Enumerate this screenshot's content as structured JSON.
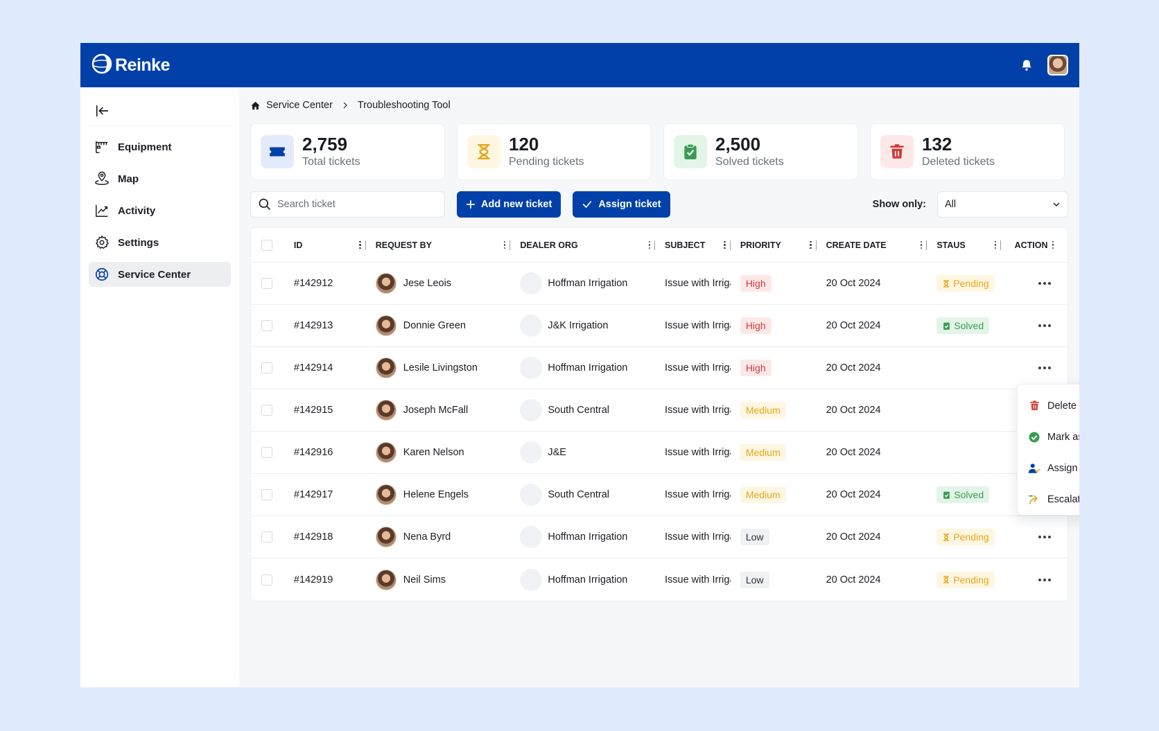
{
  "app": {
    "logo_text": "Reinke"
  },
  "sidebar": {
    "items": [
      {
        "label": "Equipment",
        "icon": "equipment-icon",
        "active": false
      },
      {
        "label": "Map",
        "icon": "map-pin-icon",
        "active": false
      },
      {
        "label": "Activity",
        "icon": "activity-icon",
        "active": false
      },
      {
        "label": "Settings",
        "icon": "gear-icon",
        "active": false
      },
      {
        "label": "Service Center",
        "icon": "lifebuoy-icon",
        "active": true
      }
    ]
  },
  "breadcrumb": {
    "items": [
      "Service Center",
      "Troubleshooting Tool"
    ]
  },
  "stats": [
    {
      "value": "2,759",
      "label": "Total tickets",
      "icon": "ticket-icon",
      "color": "#0040a8",
      "bg": "#e3ebfb"
    },
    {
      "value": "120",
      "label": "Pending tickets",
      "icon": "hourglass-icon",
      "color": "#e3a71b",
      "bg": "#fef6e0"
    },
    {
      "value": "2,500",
      "label": "Solved tickets",
      "icon": "clipboard-check-icon",
      "color": "#3a9b52",
      "bg": "#e3f5e7"
    },
    {
      "value": "132",
      "label": "Deleted tickets",
      "icon": "trash-icon",
      "color": "#d23a3a",
      "bg": "#fde8e8"
    }
  ],
  "toolbar": {
    "search_placeholder": "Search ticket",
    "add_label": "Add new ticket",
    "assign_label": "Assign ticket",
    "show_only_label": "Show only:",
    "show_only_value": "All"
  },
  "table": {
    "columns": [
      "ID",
      "REQUEST BY",
      "DEALER ORG",
      "SUBJECT",
      "PRIORITY",
      "CREATE DATE",
      "STAUS",
      "ACTION"
    ],
    "rows": [
      {
        "id": "#142912",
        "request_by": "Jese Leois",
        "dealer": "Hoffman Irrigation",
        "subject": "Issue with Irrigation",
        "priority": "High",
        "date": "20 Oct 2024",
        "status": "Pending"
      },
      {
        "id": "#142913",
        "request_by": "Donnie Green",
        "dealer": "J&K Irrigation",
        "subject": "Issue with Irrigation",
        "priority": "High",
        "date": "20 Oct 2024",
        "status": "Solved"
      },
      {
        "id": "#142914",
        "request_by": "Lesile Livingston",
        "dealer": "Hoffman Irrigation",
        "subject": "Issue with Irrigation",
        "priority": "High",
        "date": "20 Oct 2024",
        "status": ""
      },
      {
        "id": "#142915",
        "request_by": "Joseph McFall",
        "dealer": "South Central",
        "subject": "Issue with Irrigation",
        "priority": "Medium",
        "date": "20 Oct 2024",
        "status": ""
      },
      {
        "id": "#142916",
        "request_by": "Karen Nelson",
        "dealer": "J&E",
        "subject": "Issue with Irrigation",
        "priority": "Medium",
        "date": "20 Oct 2024",
        "status": ""
      },
      {
        "id": "#142917",
        "request_by": "Helene Engels",
        "dealer": "South Central",
        "subject": "Issue with Irrigation",
        "priority": "Medium",
        "date": "20 Oct 2024",
        "status": "Solved"
      },
      {
        "id": "#142918",
        "request_by": "Nena Byrd",
        "dealer": "Hoffman Irrigation",
        "subject": "Issue with Irrigation",
        "priority": "Low",
        "date": "20 Oct 2024",
        "status": "Pending"
      },
      {
        "id": "#142919",
        "request_by": "Neil Sims",
        "dealer": "Hoffman Irrigation",
        "subject": "Issue with Irrigation",
        "priority": "Low",
        "date": "20 Oct 2024",
        "status": "Pending"
      }
    ]
  },
  "action_menu": {
    "items": [
      {
        "label": "Delete",
        "icon": "trash-icon",
        "color": "#d23a3a"
      },
      {
        "label": "Mark as solved",
        "icon": "check-circle-icon",
        "color": "#3a9b52"
      },
      {
        "label": "Assign",
        "icon": "assign-user-icon",
        "color": "#0040a8"
      },
      {
        "label": "Escalate",
        "icon": "escalate-icon",
        "color": "#e3a71b"
      }
    ]
  }
}
